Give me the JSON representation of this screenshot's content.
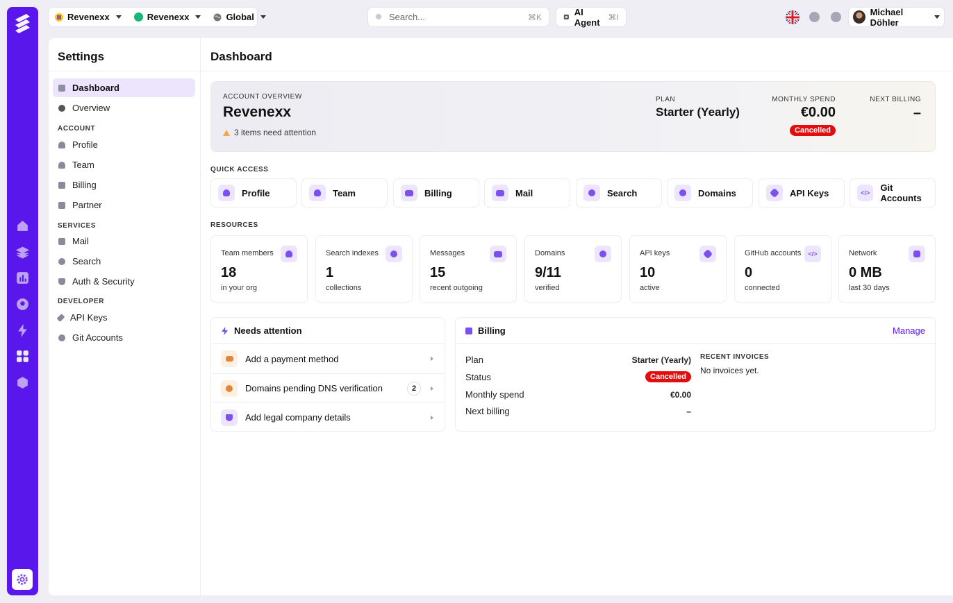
{
  "topbar": {
    "workspace1": "Revenexx",
    "workspace2": "Revenexx",
    "region": "Global",
    "search": {
      "placeholder": "Search...",
      "shortcut": "⌘K"
    },
    "ai_agent": {
      "label": "AI Agent",
      "shortcut": "⌘I"
    },
    "user": {
      "name": "Michael Döhler"
    }
  },
  "settings": {
    "title": "Settings",
    "items": [
      {
        "label": "Dashboard",
        "active": true
      },
      {
        "label": "Overview"
      }
    ],
    "sections": [
      {
        "heading": "ACCOUNT",
        "items": [
          "Profile",
          "Team",
          "Billing",
          "Partner"
        ]
      },
      {
        "heading": "SERVICES",
        "items": [
          "Mail",
          "Search",
          "Auth & Security"
        ]
      },
      {
        "heading": "DEVELOPER",
        "items": [
          "API Keys",
          "Git Accounts"
        ]
      }
    ]
  },
  "main": {
    "title": "Dashboard",
    "overview": {
      "label": "ACCOUNT OVERVIEW",
      "name": "Revenexx",
      "attention": "3 items need attention",
      "plan_label": "PLAN",
      "plan": "Starter (Yearly)",
      "spend_label": "MONTHLY SPEND",
      "spend": "€0.00",
      "status": "Cancelled",
      "billing_label": "NEXT BILLING",
      "billing": "–"
    },
    "quick_access": {
      "heading": "QUICK ACCESS",
      "items": [
        "Profile",
        "Team",
        "Billing",
        "Mail",
        "Search",
        "Domains",
        "API Keys",
        "Git Accounts"
      ]
    },
    "resources": {
      "heading": "RESOURCES",
      "items": [
        {
          "label": "Team members",
          "value": "18",
          "sub": "in your org"
        },
        {
          "label": "Search indexes",
          "value": "1",
          "sub": "collections"
        },
        {
          "label": "Messages",
          "value": "15",
          "sub": "recent outgoing"
        },
        {
          "label": "Domains",
          "value": "9/11",
          "sub": "verified"
        },
        {
          "label": "API keys",
          "value": "10",
          "sub": "active"
        },
        {
          "label": "GitHub accounts",
          "value": "0",
          "sub": "connected"
        },
        {
          "label": "Network",
          "value": "0 MB",
          "sub": "last 30 days"
        }
      ]
    },
    "attention": {
      "title": "Needs attention",
      "items": [
        {
          "label": "Add a payment method"
        },
        {
          "label": "Domains pending DNS verification",
          "count": "2"
        },
        {
          "label": "Add legal company details"
        }
      ]
    },
    "billing": {
      "title": "Billing",
      "manage": "Manage",
      "rows": [
        {
          "label": "Plan",
          "value": "Starter (Yearly)"
        },
        {
          "label": "Status",
          "value": "Cancelled"
        },
        {
          "label": "Monthly spend",
          "value": "€0.00"
        },
        {
          "label": "Next billing",
          "value": "–"
        }
      ],
      "invoices_label": "RECENT INVOICES",
      "invoices_empty": "No invoices yet."
    }
  },
  "colors": {
    "accent": "#5a17ec",
    "danger": "#e40d0d",
    "accent_soft": "#ece5fd"
  }
}
